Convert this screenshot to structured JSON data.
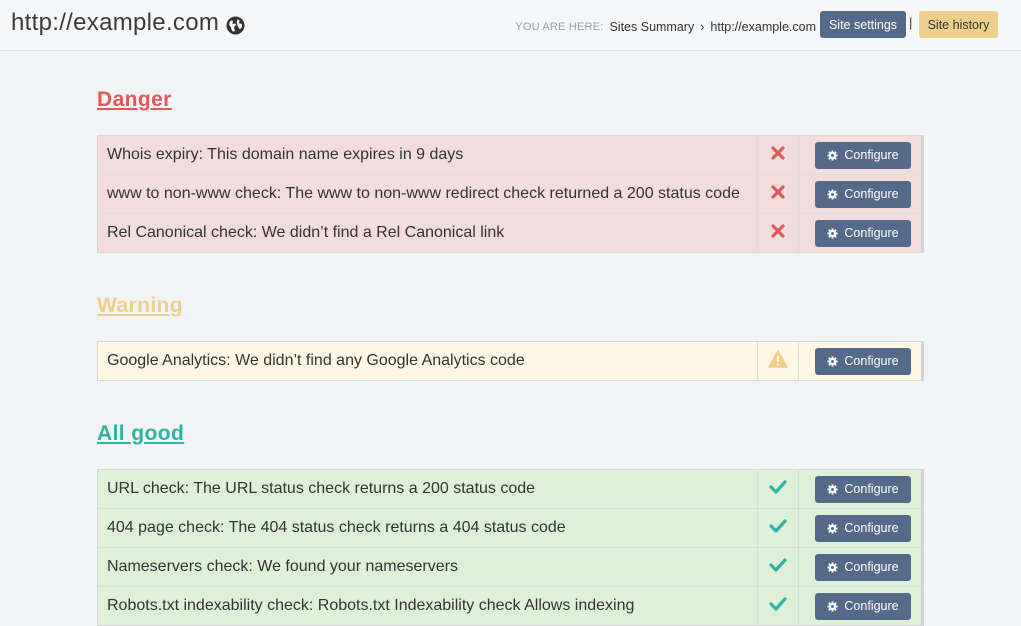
{
  "header": {
    "site_title": "http://example.com",
    "globe_icon": "globe-icon",
    "you_are_here": "YOU ARE HERE:",
    "crumb_sites": "Sites Summary",
    "crumb_sep": "›",
    "crumb_current": "http://example.com",
    "site_settings": "Site settings",
    "pipe": "|",
    "site_history": "Site history"
  },
  "sections": {
    "danger": {
      "title": "Danger",
      "color": "#df5a5a",
      "rows": [
        {
          "text": "Whois expiry: This domain name expires in 9 days",
          "button": "Configure"
        },
        {
          "text": "www to non-www check: The www to non-www redirect check returned a 200 status code",
          "button": "Configure"
        },
        {
          "text": "Rel Canonical check: We didn’t find a Rel Canonical link",
          "button": "Configure"
        }
      ]
    },
    "warning": {
      "title": "Warning",
      "color": "#efcf8c",
      "rows": [
        {
          "text": "Google Analytics: We didn’t find any Google Analytics code",
          "button": "Configure"
        }
      ]
    },
    "good": {
      "title": "All good",
      "color": "#2fb3a5",
      "rows": [
        {
          "text": "URL check: The URL status check returns a 200 status code",
          "button": "Configure"
        },
        {
          "text": "404 page check: The 404 status check returns a 404 status code",
          "button": "Configure"
        },
        {
          "text": "Nameservers check: We found your nameservers",
          "button": "Configure"
        },
        {
          "text": "Robots.txt indexability check: Robots.txt Indexability check Allows indexing",
          "button": "Configure"
        }
      ]
    }
  },
  "icons": {
    "danger": "x-icon",
    "warning": "warning-icon",
    "good": "check-icon",
    "button": "gear-icon"
  }
}
